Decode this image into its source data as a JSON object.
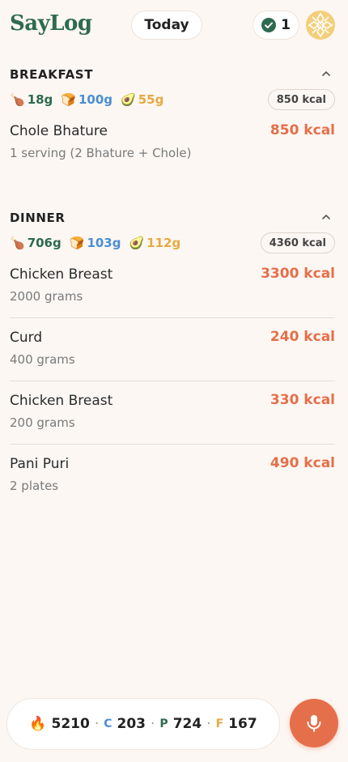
{
  "header": {
    "app_name": "SayLog",
    "date_label": "Today",
    "streak_count": "1"
  },
  "meals": [
    {
      "title": "BREAKFAST",
      "macros": {
        "protein": "18g",
        "carbs": "100g",
        "fat": "55g"
      },
      "total_kcal": "850 kcal",
      "items": [
        {
          "name": "Chole Bhature",
          "quantity": "1 serving (2 Bhature + Chole)",
          "kcal": "850 kcal"
        }
      ]
    },
    {
      "title": "DINNER",
      "macros": {
        "protein": "706g",
        "carbs": "103g",
        "fat": "112g"
      },
      "total_kcal": "4360 kcal",
      "items": [
        {
          "name": "Chicken Breast",
          "quantity": "2000 grams",
          "kcal": "3300 kcal"
        },
        {
          "name": "Curd",
          "quantity": "400 grams",
          "kcal": "240 kcal"
        },
        {
          "name": "Chicken Breast",
          "quantity": "200 grams",
          "kcal": "330 kcal"
        },
        {
          "name": "Pani Puri",
          "quantity": "2 plates",
          "kcal": "490 kcal"
        }
      ]
    }
  ],
  "summary": {
    "calories": "5210",
    "carbs_label": "C",
    "carbs": "203",
    "protein_label": "P",
    "protein": "724",
    "fat_label": "F",
    "fat": "167"
  },
  "icons": {
    "protein": "drumstick-icon",
    "carbs": "bread-icon",
    "fat": "avocado-icon",
    "calories": "fire-icon",
    "mic": "microphone-icon"
  },
  "colors": {
    "brand": "#2e6a4f",
    "accent": "#e56f4a",
    "carbs": "#4a8fd6",
    "fat": "#e6a940",
    "background": "#fcf7f3"
  }
}
